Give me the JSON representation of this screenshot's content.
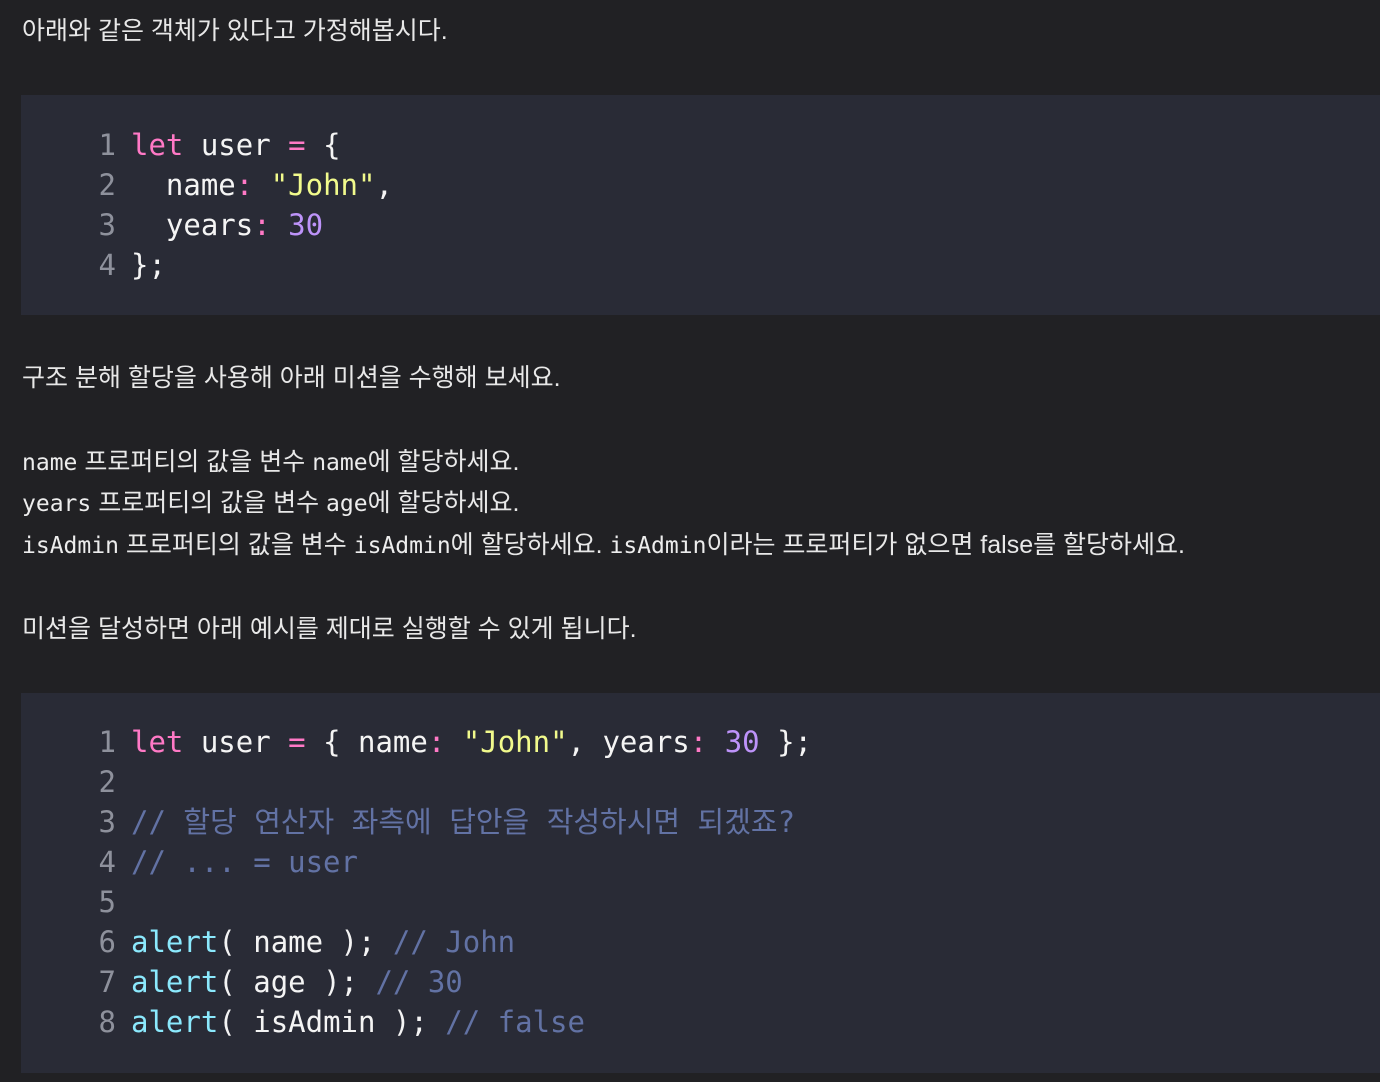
{
  "intro": "아래와 같은 객체가 있다고 가정해봅시다.",
  "code1": {
    "lines": [
      {
        "num": "1",
        "tokens": [
          {
            "t": "let",
            "c": "kw"
          },
          {
            "t": " user ",
            "c": "pl"
          },
          {
            "t": "=",
            "c": "op"
          },
          {
            "t": " {",
            "c": "pl"
          }
        ]
      },
      {
        "num": "2",
        "tokens": [
          {
            "t": "  name",
            "c": "pl"
          },
          {
            "t": ":",
            "c": "op"
          },
          {
            "t": " ",
            "c": "pl"
          },
          {
            "t": "\"John\"",
            "c": "str"
          },
          {
            "t": ",",
            "c": "pl"
          }
        ]
      },
      {
        "num": "3",
        "tokens": [
          {
            "t": "  years",
            "c": "pl"
          },
          {
            "t": ":",
            "c": "op"
          },
          {
            "t": " ",
            "c": "pl"
          },
          {
            "t": "30",
            "c": "num"
          }
        ]
      },
      {
        "num": "4",
        "tokens": [
          {
            "t": "};",
            "c": "pl"
          }
        ]
      }
    ]
  },
  "task_intro": "구조 분해 할당을 사용해 아래 미션을 수행해 보세요.",
  "tasks": [
    {
      "code1": "name",
      "text1": " 프로퍼티의 값을 변수 ",
      "code2": "name",
      "text2": "에 할당하세요.",
      "code3": "",
      "text3": ""
    },
    {
      "code1": "years",
      "text1": " 프로퍼티의 값을 변수 ",
      "code2": "age",
      "text2": "에 할당하세요.",
      "code3": "",
      "text3": ""
    },
    {
      "code1": "isAdmin",
      "text1": " 프로퍼티의 값을 변수 ",
      "code2": "isAdmin",
      "text2": "에 할당하세요. ",
      "code3": "isAdmin",
      "text3": "이라는 프로퍼티가 없으면 false를 할당하세요."
    }
  ],
  "outro": "미션을 달성하면 아래 예시를 제대로 실행할 수 있게 됩니다.",
  "code2": {
    "lines": [
      {
        "num": "1",
        "tokens": [
          {
            "t": "let",
            "c": "kw"
          },
          {
            "t": " user ",
            "c": "pl"
          },
          {
            "t": "=",
            "c": "op"
          },
          {
            "t": " { name",
            "c": "pl"
          },
          {
            "t": ":",
            "c": "op"
          },
          {
            "t": " ",
            "c": "pl"
          },
          {
            "t": "\"John\"",
            "c": "str"
          },
          {
            "t": ", years",
            "c": "pl"
          },
          {
            "t": ":",
            "c": "op"
          },
          {
            "t": " ",
            "c": "pl"
          },
          {
            "t": "30",
            "c": "num"
          },
          {
            "t": " };",
            "c": "pl"
          }
        ]
      },
      {
        "num": "2",
        "tokens": []
      },
      {
        "num": "3",
        "tokens": [
          {
            "t": "// 할당 연산자 좌측에 답안을 작성하시면 되겠죠?",
            "c": "cm"
          }
        ]
      },
      {
        "num": "4",
        "tokens": [
          {
            "t": "// ... = user",
            "c": "cm"
          }
        ]
      },
      {
        "num": "5",
        "tokens": []
      },
      {
        "num": "6",
        "tokens": [
          {
            "t": "alert",
            "c": "fn"
          },
          {
            "t": "( name ); ",
            "c": "pl"
          },
          {
            "t": "// John",
            "c": "cm"
          }
        ]
      },
      {
        "num": "7",
        "tokens": [
          {
            "t": "alert",
            "c": "fn"
          },
          {
            "t": "( age ); ",
            "c": "pl"
          },
          {
            "t": "// 30",
            "c": "cm"
          }
        ]
      },
      {
        "num": "8",
        "tokens": [
          {
            "t": "alert",
            "c": "fn"
          },
          {
            "t": "( isAdmin ); ",
            "c": "pl"
          },
          {
            "t": "// false",
            "c": "cm"
          }
        ]
      }
    ]
  }
}
